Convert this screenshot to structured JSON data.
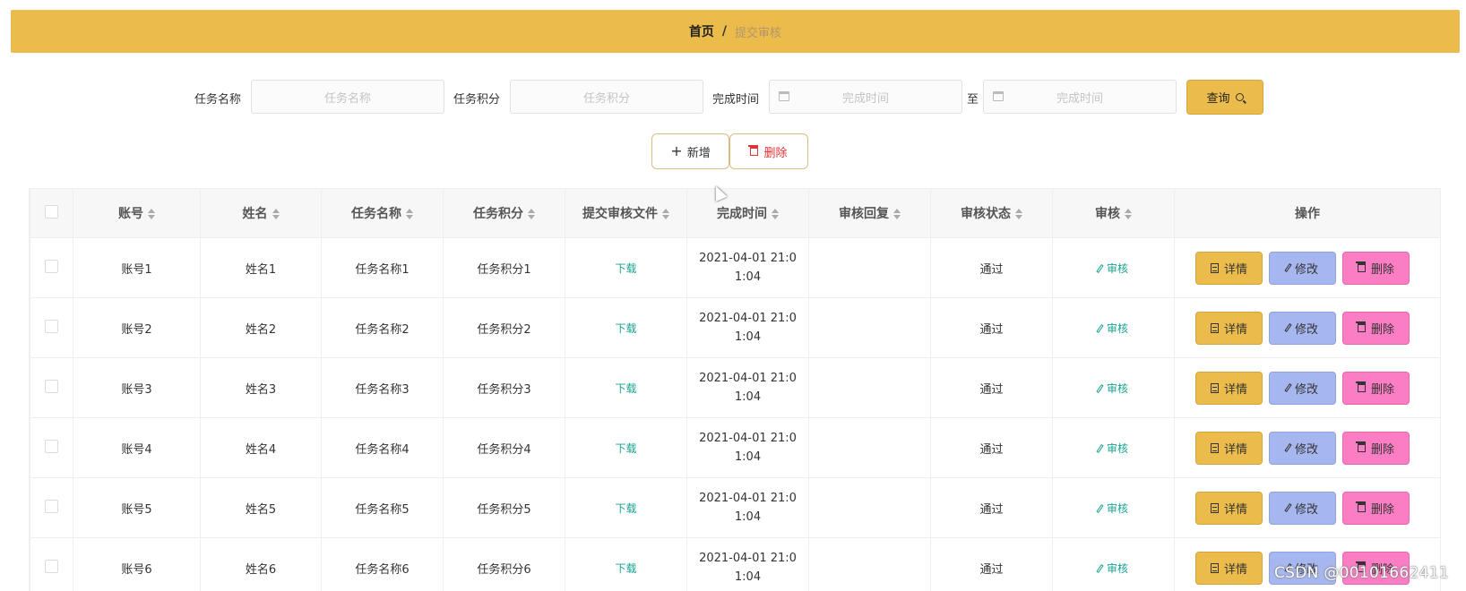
{
  "breadcrumb": {
    "home": "首页",
    "separator": "/",
    "current": "提交审核"
  },
  "search": {
    "task_name_label": "任务名称",
    "task_name_placeholder": "任务名称",
    "task_score_label": "任务积分",
    "task_score_placeholder": "任务积分",
    "finish_time_label": "完成时间",
    "finish_time_start_placeholder": "完成时间",
    "range_separator": "至",
    "finish_time_end_placeholder": "完成时间",
    "query_label": "查询"
  },
  "toolbar": {
    "add_label": "新增",
    "delete_label": "删除"
  },
  "table": {
    "columns": [
      "账号",
      "姓名",
      "任务名称",
      "任务积分",
      "提交审核文件",
      "完成时间",
      "审核回复",
      "审核状态",
      "审核",
      "操作"
    ],
    "rows": [
      {
        "account": "账号1",
        "name": "姓名1",
        "task_name": "任务名称1",
        "task_score": "任务积分1",
        "file": "下载",
        "time_line1": "2021-04-01 21:0",
        "time_line2": "1:04",
        "reply": "",
        "status": "通过",
        "audit": "审核"
      },
      {
        "account": "账号2",
        "name": "姓名2",
        "task_name": "任务名称2",
        "task_score": "任务积分2",
        "file": "下载",
        "time_line1": "2021-04-01 21:0",
        "time_line2": "1:04",
        "reply": "",
        "status": "通过",
        "audit": "审核"
      },
      {
        "account": "账号3",
        "name": "姓名3",
        "task_name": "任务名称3",
        "task_score": "任务积分3",
        "file": "下载",
        "time_line1": "2021-04-01 21:0",
        "time_line2": "1:04",
        "reply": "",
        "status": "通过",
        "audit": "审核"
      },
      {
        "account": "账号4",
        "name": "姓名4",
        "task_name": "任务名称4",
        "task_score": "任务积分4",
        "file": "下载",
        "time_line1": "2021-04-01 21:0",
        "time_line2": "1:04",
        "reply": "",
        "status": "通过",
        "audit": "审核"
      },
      {
        "account": "账号5",
        "name": "姓名5",
        "task_name": "任务名称5",
        "task_score": "任务积分5",
        "file": "下载",
        "time_line1": "2021-04-01 21:0",
        "time_line2": "1:04",
        "reply": "",
        "status": "通过",
        "audit": "审核"
      },
      {
        "account": "账号6",
        "name": "姓名6",
        "task_name": "任务名称6",
        "task_score": "任务积分6",
        "file": "下载",
        "time_line1": "2021-04-01 21:0",
        "time_line2": "1:04",
        "reply": "",
        "status": "通过",
        "audit": "审核"
      }
    ],
    "row_actions": {
      "detail": "详情",
      "edit": "修改",
      "delete": "删除"
    }
  },
  "watermark": "CSDN @00101662411",
  "colors": {
    "accent": "#ebbc4b",
    "edit": "#a6b6ef",
    "delete": "#fb7dc3",
    "link": "#1aa38f",
    "danger": "#e03434"
  },
  "icons": {
    "calendar": "calendar-icon",
    "search": "search-icon",
    "plus": "plus-icon",
    "trash": "trash-icon",
    "doc": "document-icon",
    "pen": "edit-icon",
    "sort": "sort-icon"
  }
}
